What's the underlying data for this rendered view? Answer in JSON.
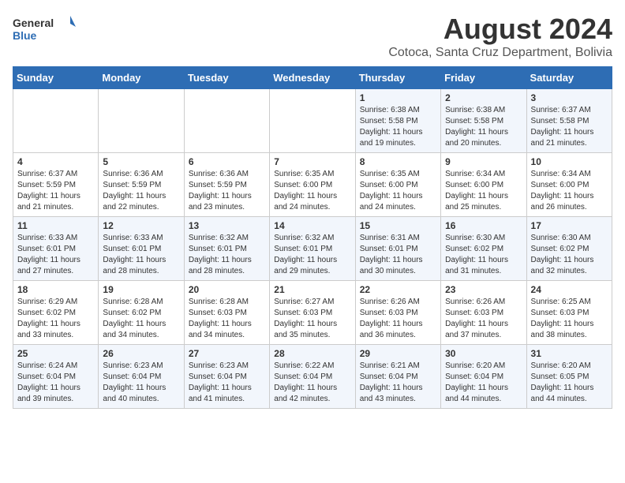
{
  "logo": {
    "text_general": "General",
    "text_blue": "Blue"
  },
  "title": "August 2024",
  "subtitle": "Cotoca, Santa Cruz Department, Bolivia",
  "days_of_week": [
    "Sunday",
    "Monday",
    "Tuesday",
    "Wednesday",
    "Thursday",
    "Friday",
    "Saturday"
  ],
  "weeks": [
    [
      {
        "day": "",
        "info": ""
      },
      {
        "day": "",
        "info": ""
      },
      {
        "day": "",
        "info": ""
      },
      {
        "day": "",
        "info": ""
      },
      {
        "day": "1",
        "info": "Sunrise: 6:38 AM\nSunset: 5:58 PM\nDaylight: 11 hours\nand 19 minutes."
      },
      {
        "day": "2",
        "info": "Sunrise: 6:38 AM\nSunset: 5:58 PM\nDaylight: 11 hours\nand 20 minutes."
      },
      {
        "day": "3",
        "info": "Sunrise: 6:37 AM\nSunset: 5:58 PM\nDaylight: 11 hours\nand 21 minutes."
      }
    ],
    [
      {
        "day": "4",
        "info": "Sunrise: 6:37 AM\nSunset: 5:59 PM\nDaylight: 11 hours\nand 21 minutes."
      },
      {
        "day": "5",
        "info": "Sunrise: 6:36 AM\nSunset: 5:59 PM\nDaylight: 11 hours\nand 22 minutes."
      },
      {
        "day": "6",
        "info": "Sunrise: 6:36 AM\nSunset: 5:59 PM\nDaylight: 11 hours\nand 23 minutes."
      },
      {
        "day": "7",
        "info": "Sunrise: 6:35 AM\nSunset: 6:00 PM\nDaylight: 11 hours\nand 24 minutes."
      },
      {
        "day": "8",
        "info": "Sunrise: 6:35 AM\nSunset: 6:00 PM\nDaylight: 11 hours\nand 24 minutes."
      },
      {
        "day": "9",
        "info": "Sunrise: 6:34 AM\nSunset: 6:00 PM\nDaylight: 11 hours\nand 25 minutes."
      },
      {
        "day": "10",
        "info": "Sunrise: 6:34 AM\nSunset: 6:00 PM\nDaylight: 11 hours\nand 26 minutes."
      }
    ],
    [
      {
        "day": "11",
        "info": "Sunrise: 6:33 AM\nSunset: 6:01 PM\nDaylight: 11 hours\nand 27 minutes."
      },
      {
        "day": "12",
        "info": "Sunrise: 6:33 AM\nSunset: 6:01 PM\nDaylight: 11 hours\nand 28 minutes."
      },
      {
        "day": "13",
        "info": "Sunrise: 6:32 AM\nSunset: 6:01 PM\nDaylight: 11 hours\nand 28 minutes."
      },
      {
        "day": "14",
        "info": "Sunrise: 6:32 AM\nSunset: 6:01 PM\nDaylight: 11 hours\nand 29 minutes."
      },
      {
        "day": "15",
        "info": "Sunrise: 6:31 AM\nSunset: 6:01 PM\nDaylight: 11 hours\nand 30 minutes."
      },
      {
        "day": "16",
        "info": "Sunrise: 6:30 AM\nSunset: 6:02 PM\nDaylight: 11 hours\nand 31 minutes."
      },
      {
        "day": "17",
        "info": "Sunrise: 6:30 AM\nSunset: 6:02 PM\nDaylight: 11 hours\nand 32 minutes."
      }
    ],
    [
      {
        "day": "18",
        "info": "Sunrise: 6:29 AM\nSunset: 6:02 PM\nDaylight: 11 hours\nand 33 minutes."
      },
      {
        "day": "19",
        "info": "Sunrise: 6:28 AM\nSunset: 6:02 PM\nDaylight: 11 hours\nand 34 minutes."
      },
      {
        "day": "20",
        "info": "Sunrise: 6:28 AM\nSunset: 6:03 PM\nDaylight: 11 hours\nand 34 minutes."
      },
      {
        "day": "21",
        "info": "Sunrise: 6:27 AM\nSunset: 6:03 PM\nDaylight: 11 hours\nand 35 minutes."
      },
      {
        "day": "22",
        "info": "Sunrise: 6:26 AM\nSunset: 6:03 PM\nDaylight: 11 hours\nand 36 minutes."
      },
      {
        "day": "23",
        "info": "Sunrise: 6:26 AM\nSunset: 6:03 PM\nDaylight: 11 hours\nand 37 minutes."
      },
      {
        "day": "24",
        "info": "Sunrise: 6:25 AM\nSunset: 6:03 PM\nDaylight: 11 hours\nand 38 minutes."
      }
    ],
    [
      {
        "day": "25",
        "info": "Sunrise: 6:24 AM\nSunset: 6:04 PM\nDaylight: 11 hours\nand 39 minutes."
      },
      {
        "day": "26",
        "info": "Sunrise: 6:23 AM\nSunset: 6:04 PM\nDaylight: 11 hours\nand 40 minutes."
      },
      {
        "day": "27",
        "info": "Sunrise: 6:23 AM\nSunset: 6:04 PM\nDaylight: 11 hours\nand 41 minutes."
      },
      {
        "day": "28",
        "info": "Sunrise: 6:22 AM\nSunset: 6:04 PM\nDaylight: 11 hours\nand 42 minutes."
      },
      {
        "day": "29",
        "info": "Sunrise: 6:21 AM\nSunset: 6:04 PM\nDaylight: 11 hours\nand 43 minutes."
      },
      {
        "day": "30",
        "info": "Sunrise: 6:20 AM\nSunset: 6:04 PM\nDaylight: 11 hours\nand 44 minutes."
      },
      {
        "day": "31",
        "info": "Sunrise: 6:20 AM\nSunset: 6:05 PM\nDaylight: 11 hours\nand 44 minutes."
      }
    ]
  ]
}
